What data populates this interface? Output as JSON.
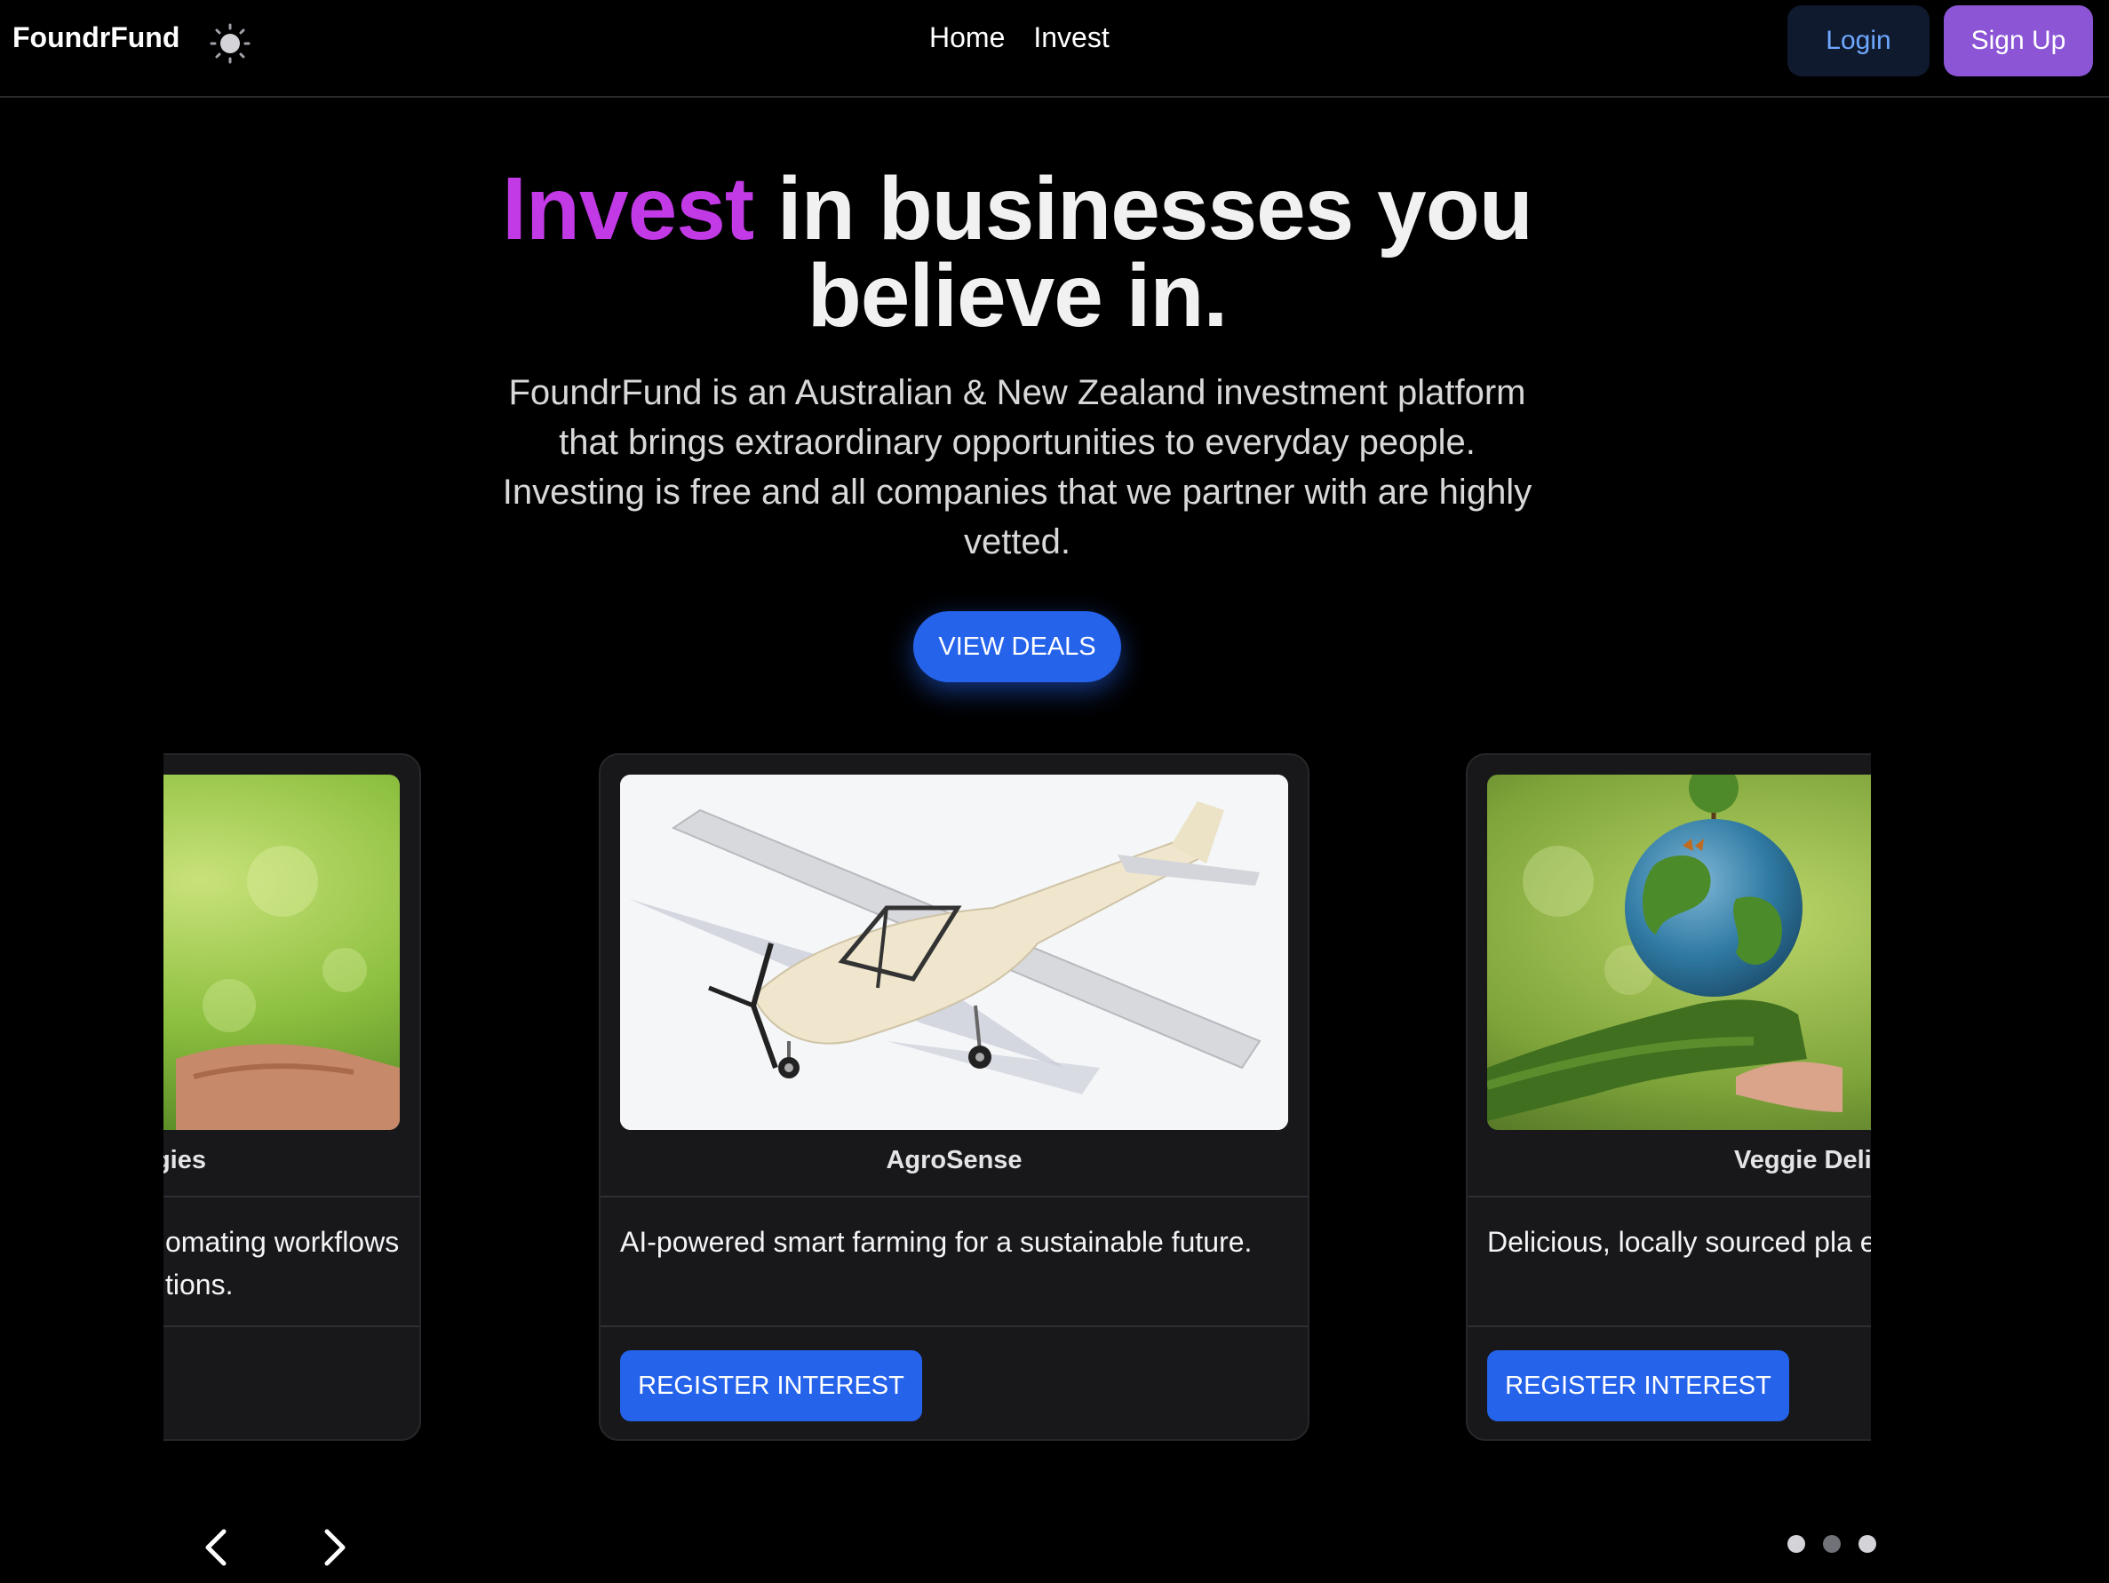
{
  "header": {
    "brand": "FoundrFund",
    "nav": [
      {
        "label": "Home"
      },
      {
        "label": "Invest"
      }
    ],
    "login_label": "Login",
    "signup_label": "Sign Up",
    "theme_icon": "sun-icon"
  },
  "hero": {
    "title_accent": "Invest",
    "title_rest": " in businesses you believe in.",
    "description": "FoundrFund is an Australian & New Zealand investment platform that brings extraordinary opportunities to everyday people. Investing is free and all companies that we partner with are highly vetted.",
    "cta_label": "VIEW DEALS",
    "accent_color": "#c13ae6"
  },
  "deals": [
    {
      "name": "ogies",
      "description": "omating workflows tions.",
      "image": "hands-nature-photo",
      "button_label": ""
    },
    {
      "name": "AgroSense",
      "description": "AI-powered smart farming for a sustainable future.",
      "image": "light-aircraft-render",
      "button_label": "REGISTER INTEREST"
    },
    {
      "name": "Veggie Deli",
      "description": "Delicious, locally sourced pla everyone.",
      "image": "earth-in-hands-photo",
      "button_label": "REGISTER INTEREST"
    }
  ],
  "carousel": {
    "prev_icon": "chevron-left-icon",
    "next_icon": "chevron-right-icon",
    "dot_count": 3,
    "active_dot": 1
  },
  "colors": {
    "primary": "#2563eb",
    "signup": "#8b55d6",
    "background": "#000000",
    "card": "#18181b"
  }
}
